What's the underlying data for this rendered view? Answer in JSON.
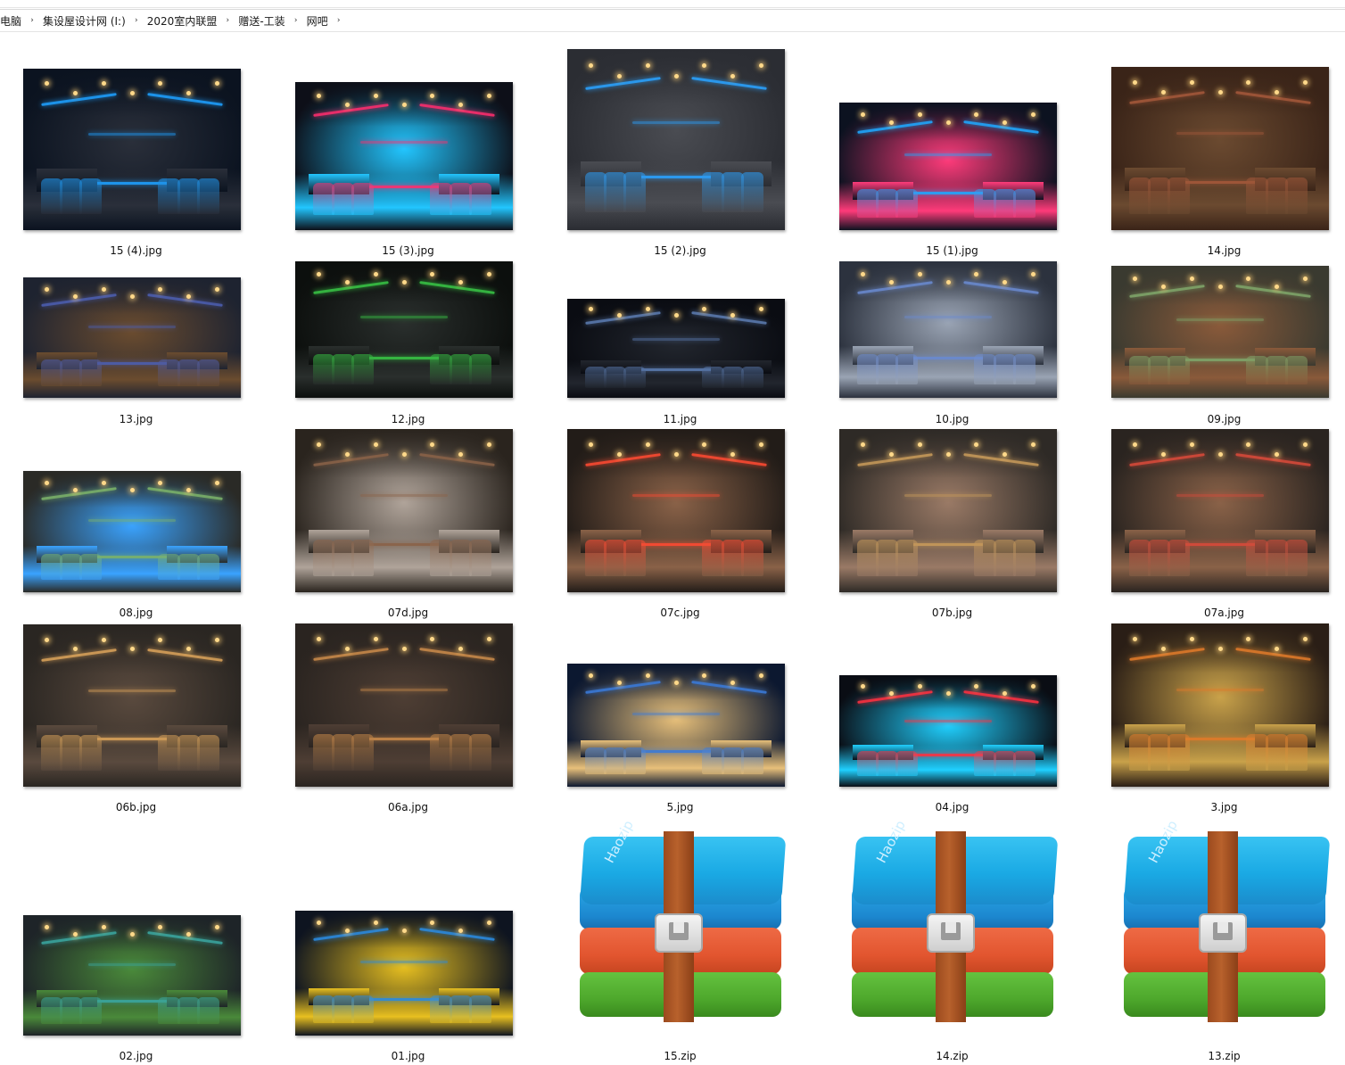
{
  "breadcrumb": {
    "items": [
      "电脑",
      "集设屋设计网 (I:)",
      "2020室内联盟",
      "赠送-工装",
      "网吧"
    ],
    "separator": "›"
  },
  "files": [
    {
      "name": "15 (4).jpg",
      "kind": "image",
      "palette": [
        "#0b1320",
        "#1ea0ff",
        "#2a2f3a"
      ]
    },
    {
      "name": "15 (3).jpg",
      "kind": "image",
      "palette": [
        "#0d0f18",
        "#ff2d6e",
        "#22c6ff"
      ]
    },
    {
      "name": "15 (2).jpg",
      "kind": "image",
      "palette": [
        "#2b2d33",
        "#2aa2ff",
        "#4a4c52"
      ]
    },
    {
      "name": "15 (1).jpg",
      "kind": "image",
      "palette": [
        "#0c1220",
        "#1fa8ff",
        "#ff3b7a"
      ]
    },
    {
      "name": "14.jpg",
      "kind": "image",
      "palette": [
        "#3a2418",
        "#a4583a",
        "#6b4a30"
      ]
    },
    {
      "name": "13.jpg",
      "kind": "image",
      "palette": [
        "#1e2330",
        "#4c5eb0",
        "#6b4c2f"
      ]
    },
    {
      "name": "12.jpg",
      "kind": "image",
      "palette": [
        "#0c0f0d",
        "#38c445",
        "#2a2f2d"
      ]
    },
    {
      "name": "11.jpg",
      "kind": "image",
      "palette": [
        "#0a0c12",
        "#5b7bb0",
        "#22262e"
      ]
    },
    {
      "name": "10.jpg",
      "kind": "image",
      "palette": [
        "#2c323e",
        "#6a8ad0",
        "#9aa4b4"
      ]
    },
    {
      "name": "09.jpg",
      "kind": "image",
      "palette": [
        "#3a3a30",
        "#7fa66a",
        "#8a5a3a"
      ]
    },
    {
      "name": "08.jpg",
      "kind": "image",
      "palette": [
        "#2a2a26",
        "#7bb26a",
        "#3aa3ff"
      ]
    },
    {
      "name": "07d.jpg",
      "kind": "image",
      "palette": [
        "#2a241e",
        "#8a6248",
        "#b0a49a"
      ]
    },
    {
      "name": "07c.jpg",
      "kind": "image",
      "palette": [
        "#221c18",
        "#ff4a32",
        "#8a6248"
      ]
    },
    {
      "name": "07b.jpg",
      "kind": "image",
      "palette": [
        "#2e2a26",
        "#c79a5a",
        "#9a7a66"
      ]
    },
    {
      "name": "07a.jpg",
      "kind": "image",
      "palette": [
        "#2a2420",
        "#d94a3a",
        "#8a6248"
      ]
    },
    {
      "name": "06b.jpg",
      "kind": "image",
      "palette": [
        "#2a2622",
        "#d9a25a",
        "#5a4a3e"
      ]
    },
    {
      "name": "06a.jpg",
      "kind": "image",
      "palette": [
        "#2a2420",
        "#c98a4a",
        "#4e3e34"
      ]
    },
    {
      "name": "5.jpg",
      "kind": "image",
      "palette": [
        "#0c1830",
        "#3a7ad9",
        "#e8c07a"
      ]
    },
    {
      "name": "04.jpg",
      "kind": "image",
      "palette": [
        "#0a0d14",
        "#ff3040",
        "#20d0ff"
      ]
    },
    {
      "name": "3.jpg",
      "kind": "image",
      "palette": [
        "#2a1e16",
        "#e07a2a",
        "#c9a24a"
      ]
    },
    {
      "name": "02.jpg",
      "kind": "image",
      "palette": [
        "#1e2428",
        "#3aa6a0",
        "#4a8a3a"
      ]
    },
    {
      "name": "01.jpg",
      "kind": "image",
      "palette": [
        "#0e1420",
        "#2a8ae0",
        "#e8c020"
      ]
    },
    {
      "name": "15.zip",
      "kind": "archive",
      "brand": "Haozip"
    },
    {
      "name": "14.zip",
      "kind": "archive",
      "brand": "Haozip"
    },
    {
      "name": "13.zip",
      "kind": "archive",
      "brand": "Haozip"
    }
  ]
}
